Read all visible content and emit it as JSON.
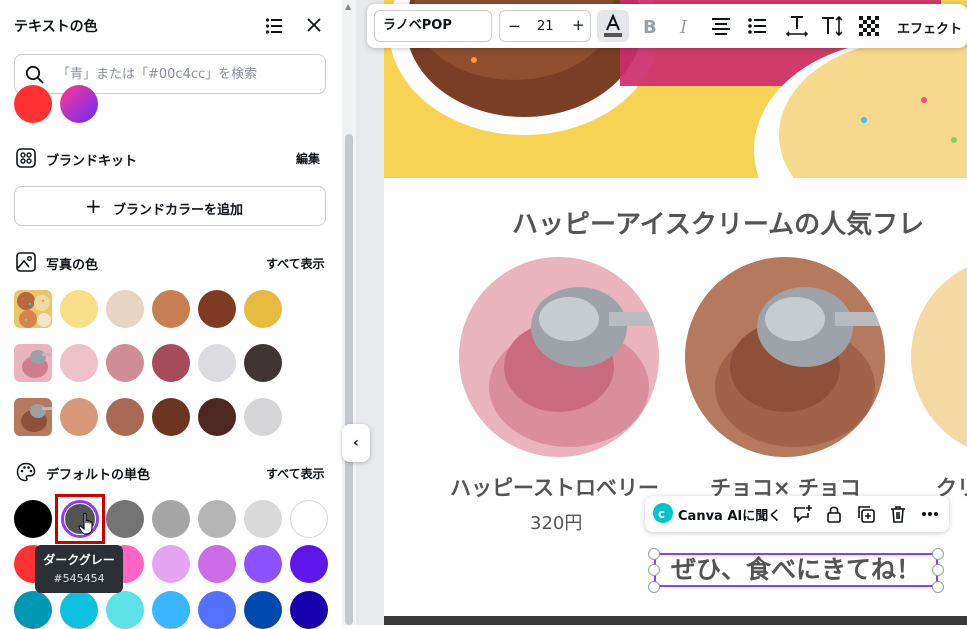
{
  "panel": {
    "title": "テキストの色",
    "search_placeholder": "「青」または「#00c4cc」を検索",
    "top_row": [
      "#ff3131",
      "gradient"
    ],
    "brand_kit": {
      "title": "ブランドキット",
      "action": "編集",
      "add_label": "ブランドカラーを追加"
    },
    "photo_colors": {
      "title": "写真の色",
      "action": "すべて表示",
      "rows": [
        [
          "#f7df8a",
          "#e6d5c2",
          "#c97e52",
          "#7f3a22",
          "#e6b93f"
        ],
        [
          "#eec1ca",
          "#cf8e97",
          "#a54b5b",
          "#dcdce0",
          "#3f3535"
        ],
        [
          "#d7987a",
          "#a86a55",
          "#6b3522",
          "#4c2820",
          "#d5d5d7"
        ]
      ]
    },
    "default_colors": {
      "title": "デフォルトの単色",
      "action": "すべて表示",
      "rows": [
        [
          "#000000",
          "#545454",
          "#737373",
          "#a6a6a6",
          "#b4b4b4",
          "#d9d9d9",
          "#ffffff"
        ],
        [
          "#ff3131",
          "#ff5757",
          "#ff66c4",
          "#e4a4f0",
          "#cb6ce6",
          "#8c52ff",
          "#5e17eb"
        ],
        [
          "#0097b2",
          "#0cc0df",
          "#5ce1e6",
          "#38b6ff",
          "#5271ff",
          "#004aad",
          "#1800ad"
        ]
      ]
    },
    "tooltip": {
      "name": "ダークグレー",
      "hex": "#545454"
    }
  },
  "toolbar": {
    "font": "ラノベPOP",
    "minus": "−",
    "size": "21",
    "plus": "+",
    "effects": "エフェクト"
  },
  "canvas": {
    "heading": "ハッピーアイスクリームの人気フレ",
    "flavors": [
      {
        "name": "ハッピーストロベリー",
        "price": "320円"
      },
      {
        "name": "チョコ× チョコ"
      },
      {
        "name": "クリ"
      }
    ],
    "selected_text": "ぜひ、食べにきてね！"
  },
  "context_menu": {
    "ai_label": "Canva AIに聞く"
  }
}
